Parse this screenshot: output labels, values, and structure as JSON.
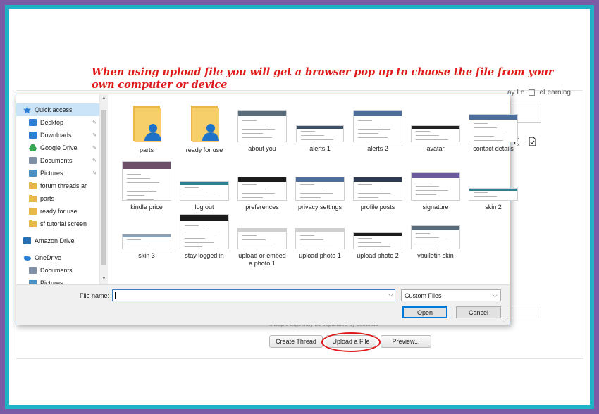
{
  "caption": "When using upload file you will get a browser pop up to choose the file from your own computer or device",
  "background_page": {
    "top_right_label": "eLearning",
    "top_right_partial": "ay Lo",
    "hint_text": "Multiple tags may be separated by commas",
    "buttons": {
      "create_thread": "Create Thread",
      "upload_file": "Upload a File",
      "preview": "Preview..."
    },
    "toolbar_icons": [
      "clear-format-icon",
      "spellcheck-icon"
    ]
  },
  "dialog": {
    "nav": [
      {
        "label": "Quick access",
        "icon": "star-icon",
        "pinned": false
      },
      {
        "label": "Desktop",
        "icon": "desktop-icon",
        "pinned": true
      },
      {
        "label": "Downloads",
        "icon": "download-icon",
        "pinned": true
      },
      {
        "label": "Google Drive",
        "icon": "google-drive-icon",
        "pinned": true
      },
      {
        "label": "Documents",
        "icon": "documents-icon",
        "pinned": true
      },
      {
        "label": "Pictures",
        "icon": "pictures-icon",
        "pinned": true
      },
      {
        "label": "forum threads ar",
        "icon": "folder-icon",
        "pinned": false
      },
      {
        "label": "parts",
        "icon": "folder-icon",
        "pinned": false
      },
      {
        "label": "ready for use",
        "icon": "folder-icon",
        "pinned": false
      },
      {
        "label": "sf tutorial screen",
        "icon": "folder-icon",
        "pinned": false
      },
      {
        "label": "Amazon Drive",
        "icon": "amazon-drive-icon",
        "pinned": false
      },
      {
        "label": "OneDrive",
        "icon": "onedrive-icon",
        "pinned": false
      },
      {
        "label": "Documents",
        "icon": "documents-icon",
        "pinned": false
      },
      {
        "label": "Pictures",
        "icon": "pictures-icon",
        "pinned": false
      }
    ],
    "files": [
      {
        "name": "parts",
        "kind": "folder"
      },
      {
        "name": "ready for use",
        "kind": "folder"
      },
      {
        "name": "about you",
        "kind": "image"
      },
      {
        "name": "alerts 1",
        "kind": "image"
      },
      {
        "name": "alerts 2",
        "kind": "image"
      },
      {
        "name": "avatar",
        "kind": "image"
      },
      {
        "name": "contact details",
        "kind": "image"
      },
      {
        "name": "kindle price",
        "kind": "image"
      },
      {
        "name": "log out",
        "kind": "image"
      },
      {
        "name": "preferences",
        "kind": "image"
      },
      {
        "name": "privacy settings",
        "kind": "image"
      },
      {
        "name": "profile posts",
        "kind": "image"
      },
      {
        "name": "signature",
        "kind": "image"
      },
      {
        "name": "skin 2",
        "kind": "image"
      },
      {
        "name": "skin 3",
        "kind": "image"
      },
      {
        "name": "stay logged in",
        "kind": "image"
      },
      {
        "name": "upload or embed a photo 1",
        "kind": "image"
      },
      {
        "name": "upload photo 1",
        "kind": "image"
      },
      {
        "name": "upload photo 2",
        "kind": "image"
      },
      {
        "name": "vbulletin skin",
        "kind": "image"
      }
    ],
    "file_name_label": "File name:",
    "file_name_value": "",
    "file_type": "Custom Files",
    "open_label": "Open",
    "cancel_label": "Cancel"
  },
  "colors": {
    "outer_frame": "#7b5aa6",
    "inner_frame": "#1fb2c7",
    "caption": "#e01b1b",
    "highlight": "#e0191b",
    "nav_selected": "#cce4f7",
    "folder": "#f6cf6b",
    "folder_person": "#1e73c8"
  }
}
